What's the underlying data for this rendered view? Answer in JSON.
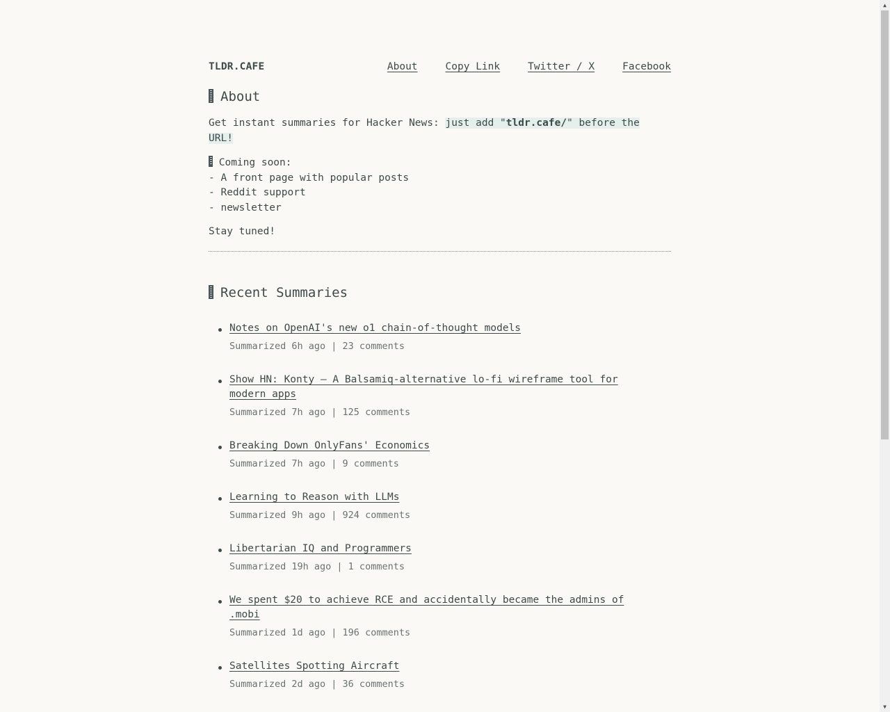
{
  "header": {
    "brand": "TLDR.CAFE",
    "nav": [
      {
        "label": "About"
      },
      {
        "label": "Copy Link"
      },
      {
        "label": "Twitter / X"
      },
      {
        "label": "Facebook"
      }
    ]
  },
  "about": {
    "icon": "missing-emoji-icon",
    "title": "About",
    "intro_prefix": "Get instant summaries for Hacker News: ",
    "intro_code_before": "just add \"",
    "intro_code_bold": "tldr.cafe/",
    "intro_code_after": "\" before the URL!",
    "coming_soon_icon": "missing-emoji-icon",
    "coming_soon_title": "Coming soon:",
    "coming_soon_items": [
      "- A front page with popular posts",
      "- Reddit support",
      "- newsletter"
    ],
    "stay_tuned": "Stay tuned!"
  },
  "recent": {
    "icon": "missing-emoji-icon",
    "title": "Recent Summaries",
    "items": [
      {
        "title": "Notes on OpenAI's new o1 chain-of-thought models",
        "meta": "Summarized 6h ago | 23 comments"
      },
      {
        "title": "Show HN: Konty – A Balsamiq-alternative lo-fi wireframe tool for modern apps",
        "meta": "Summarized 7h ago | 125 comments"
      },
      {
        "title": "Breaking Down OnlyFans' Economics",
        "meta": "Summarized 7h ago | 9 comments"
      },
      {
        "title": "Learning to Reason with LLMs",
        "meta": "Summarized 9h ago | 924 comments"
      },
      {
        "title": "Libertarian IQ and Programmers",
        "meta": "Summarized 19h ago | 1 comments"
      },
      {
        "title": "We spent $20 to achieve RCE and accidentally became the admins of .mobi",
        "meta": "Summarized 1d ago | 196 comments"
      },
      {
        "title": "Satellites Spotting Aircraft",
        "meta": "Summarized 2d ago | 36 comments"
      }
    ]
  },
  "scrollbar": {
    "up_icon": "▲",
    "down_icon": "▼"
  }
}
